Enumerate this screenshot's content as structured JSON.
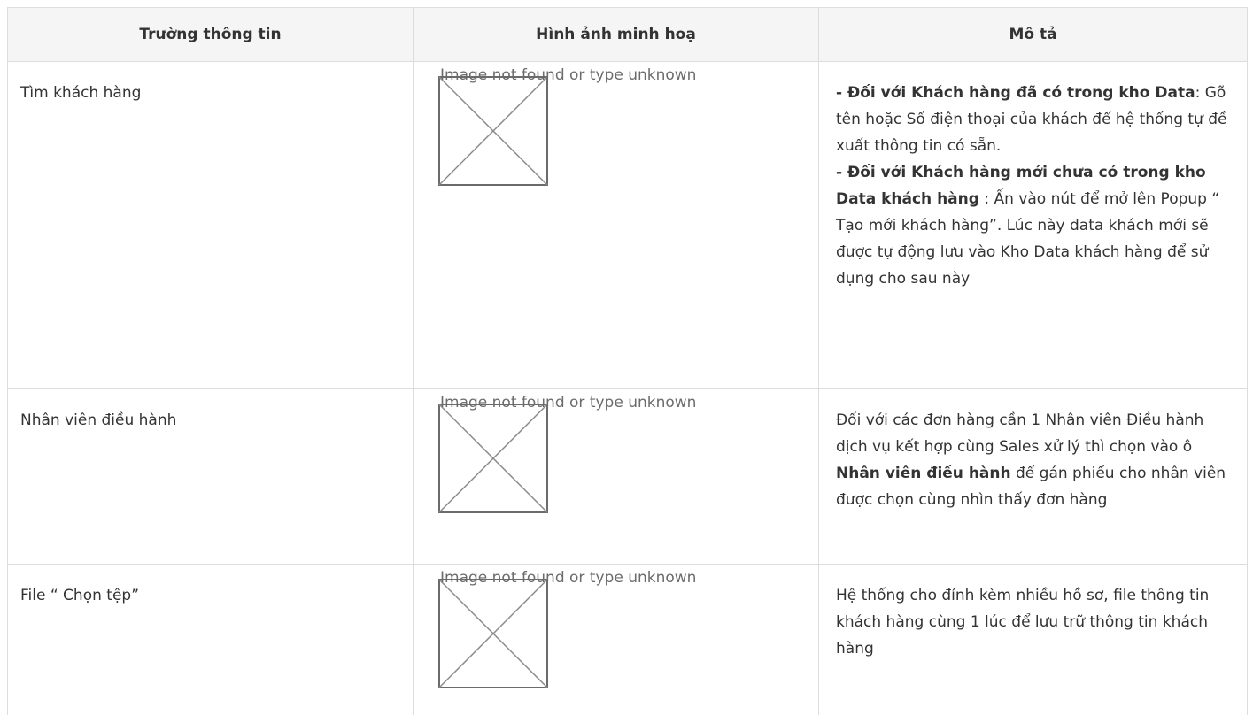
{
  "table": {
    "headers": [
      "Trường thông tin",
      "Hình ảnh minh hoạ",
      "Mô tả"
    ],
    "rows": [
      {
        "field": "Tìm khách hàng",
        "image_alt": "Image not found or type unknown",
        "desc_parts": [
          {
            "bold": "- Đối với Khách hàng đã có trong kho Data",
            "text": ": Gõ tên hoặc Số điện thoại của khách để hệ thống tự đề xuất thông tin có sẵn."
          },
          {
            "bold": "- Đối với Khách hàng mới chưa có trong kho Data khách hàng",
            "text": " : Ấn vào nút để mở lên Popup “ Tạo mới khách hàng”. Lúc này data khách mới sẽ được tự động lưu vào Kho Data khách hàng để sử dụng cho sau này"
          }
        ]
      },
      {
        "field": "Nhân viên điều hành",
        "image_alt": "Image not found or type unknown",
        "desc_before": "Đối với các đơn hàng cần 1 Nhân viên Điều hành dịch vụ kết hợp cùng Sales xử lý thì chọn vào ô ",
        "desc_bold": "Nhân viên điều hành",
        "desc_after": " để gán phiếu cho nhân viên được chọn cùng nhìn thấy đơn hàng"
      },
      {
        "field": "File “ Chọn tệp”",
        "image_alt": "Image not found or type unknown",
        "desc": "Hệ thống cho đính kèm nhiều hồ sơ, file thông tin khách hàng cùng 1 lúc để lưu trữ thông tin khách hàng"
      }
    ]
  },
  "colors": {
    "border": "#dddddd",
    "header_bg": "#f5f5f5",
    "text": "#333333",
    "placeholder": "#6b6b6b"
  },
  "icons": {
    "broken_image": "broken-image-icon"
  }
}
